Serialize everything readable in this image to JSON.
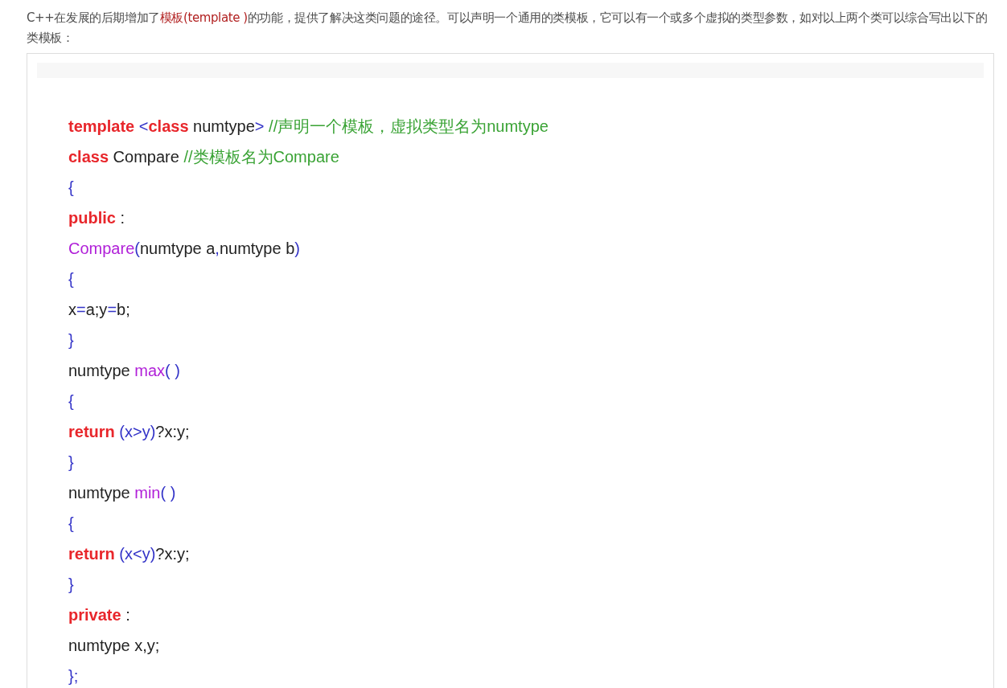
{
  "intro": [
    {
      "kind": "plain",
      "text": "C++在发展的后期增加了"
    },
    {
      "kind": "highlight",
      "text": "模板(template )"
    },
    {
      "kind": "plain",
      "text": "的功能，提供了解决这类问题的途径。可以声明一个通用的类模板，它可以有一个或多个虚拟的类型参数，如对以上两个类可以综合写出以下的类模板："
    }
  ],
  "code_lines": [
    [
      {
        "kind": "keyword",
        "text": "template"
      },
      {
        "kind": "punct",
        "text": " <"
      },
      {
        "kind": "keyword",
        "text": "class"
      },
      {
        "kind": "plain",
        "text": " numtype"
      },
      {
        "kind": "punct",
        "text": ">"
      },
      {
        "kind": "comment",
        "text": " //声明一个模板，虚拟类型名为numtype"
      }
    ],
    [
      {
        "kind": "keyword",
        "text": "class"
      },
      {
        "kind": "plain",
        "text": " Compare "
      },
      {
        "kind": "comment",
        "text": "//类模板名为Compare"
      }
    ],
    [
      {
        "kind": "punct",
        "text": "{"
      }
    ],
    [
      {
        "kind": "keyword",
        "text": "public"
      },
      {
        "kind": "plain",
        "text": " :"
      }
    ],
    [
      {
        "kind": "func",
        "text": "Compare"
      },
      {
        "kind": "punct",
        "text": "("
      },
      {
        "kind": "plain",
        "text": "numtype a"
      },
      {
        "kind": "punct",
        "text": ","
      },
      {
        "kind": "plain",
        "text": "numtype b"
      },
      {
        "kind": "punct",
        "text": ")"
      }
    ],
    [
      {
        "kind": "punct",
        "text": "{"
      }
    ],
    [
      {
        "kind": "plain",
        "text": "x"
      },
      {
        "kind": "punct",
        "text": "="
      },
      {
        "kind": "plain",
        "text": "a;y"
      },
      {
        "kind": "punct",
        "text": "="
      },
      {
        "kind": "plain",
        "text": "b;"
      }
    ],
    [
      {
        "kind": "punct",
        "text": "}"
      }
    ],
    [
      {
        "kind": "plain",
        "text": "numtype "
      },
      {
        "kind": "func",
        "text": "max"
      },
      {
        "kind": "punct",
        "text": "( )"
      }
    ],
    [
      {
        "kind": "punct",
        "text": "{"
      }
    ],
    [
      {
        "kind": "keyword",
        "text": "return"
      },
      {
        "kind": "punct",
        "text": " (x>y)"
      },
      {
        "kind": "plain",
        "text": "?x:y;"
      }
    ],
    [
      {
        "kind": "punct",
        "text": "}"
      }
    ],
    [
      {
        "kind": "plain",
        "text": "numtype "
      },
      {
        "kind": "func",
        "text": "min"
      },
      {
        "kind": "punct",
        "text": "( )"
      }
    ],
    [
      {
        "kind": "punct",
        "text": "{"
      }
    ],
    [
      {
        "kind": "keyword",
        "text": "return"
      },
      {
        "kind": "punct",
        "text": " (x<y)"
      },
      {
        "kind": "plain",
        "text": "?x:y;"
      }
    ],
    [
      {
        "kind": "punct",
        "text": "}"
      }
    ],
    [
      {
        "kind": "keyword",
        "text": "private"
      },
      {
        "kind": "plain",
        "text": " :"
      }
    ],
    [
      {
        "kind": "plain",
        "text": "numtype x,y;"
      }
    ],
    [
      {
        "kind": "punct",
        "text": "};"
      }
    ]
  ]
}
